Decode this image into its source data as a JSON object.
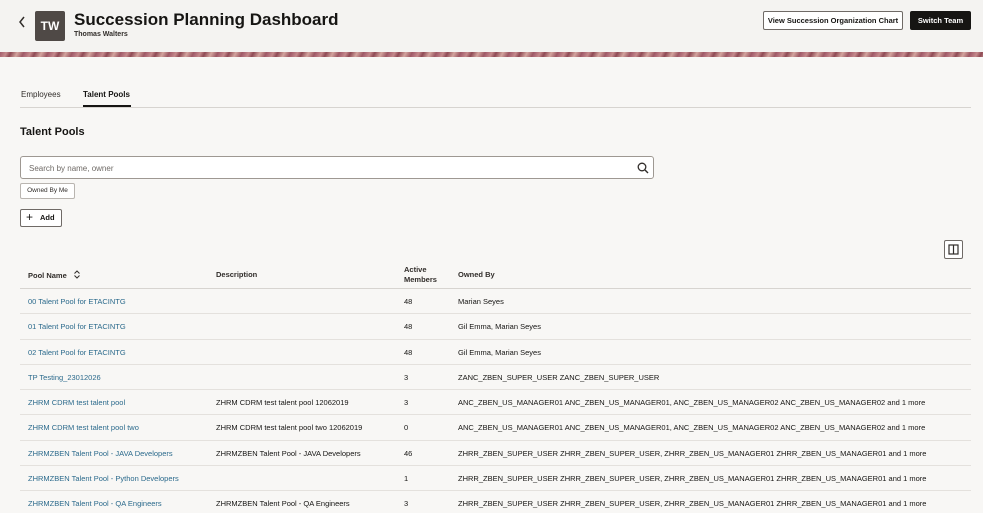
{
  "header": {
    "title": "Succession Planning Dashboard",
    "subtitle": "Thomas Walters",
    "avatar_initials": "TW",
    "back_icon": "chevron-left-icon",
    "org_chart_button": "View Succession Organization Chart",
    "switch_team_button": "Switch Team"
  },
  "tabs": [
    {
      "label": "Employees",
      "active": false
    },
    {
      "label": "Talent Pools",
      "active": true
    }
  ],
  "section_title": "Talent Pools",
  "search": {
    "placeholder": "Search by name, owner",
    "value": ""
  },
  "filter_chip": "Owned By Me",
  "add_button": "Add",
  "table": {
    "columns": [
      "Pool Name",
      "Description",
      "Active Members",
      "Owned By"
    ],
    "rows": [
      {
        "name": "00 Talent Pool for ETACINTG",
        "description": "",
        "members": "48",
        "owner": "Marian Seyes"
      },
      {
        "name": "01 Talent Pool for ETACINTG",
        "description": "",
        "members": "48",
        "owner": "Gil Emma, Marian Seyes"
      },
      {
        "name": "02 Talent Pool for ETACINTG",
        "description": "",
        "members": "48",
        "owner": "Gil Emma, Marian Seyes"
      },
      {
        "name": "TP Testing_23012026",
        "description": "",
        "members": "3",
        "owner": "ZANC_ZBEN_SUPER_USER ZANC_ZBEN_SUPER_USER"
      },
      {
        "name": "ZHRM CDRM test talent pool",
        "description": "ZHRM CDRM test talent pool 12062019",
        "members": "3",
        "owner": "ANC_ZBEN_US_MANAGER01 ANC_ZBEN_US_MANAGER01, ANC_ZBEN_US_MANAGER02 ANC_ZBEN_US_MANAGER02 and 1 more"
      },
      {
        "name": "ZHRM CDRM test talent pool two",
        "description": "ZHRM CDRM test talent pool two 12062019",
        "members": "0",
        "owner": "ANC_ZBEN_US_MANAGER01 ANC_ZBEN_US_MANAGER01, ANC_ZBEN_US_MANAGER02 ANC_ZBEN_US_MANAGER02 and 1 more"
      },
      {
        "name": "ZHRMZBEN Talent Pool - JAVA Developers",
        "description": "ZHRMZBEN Talent Pool - JAVA Developers",
        "members": "46",
        "owner": "ZHRR_ZBEN_SUPER_USER ZHRR_ZBEN_SUPER_USER, ZHRR_ZBEN_US_MANAGER01 ZHRR_ZBEN_US_MANAGER01 and 1 more"
      },
      {
        "name": "ZHRMZBEN Talent Pool - Python Developers",
        "description": "",
        "members": "1",
        "owner": "ZHRR_ZBEN_SUPER_USER ZHRR_ZBEN_SUPER_USER, ZHRR_ZBEN_US_MANAGER01 ZHRR_ZBEN_US_MANAGER01 and 1 more"
      },
      {
        "name": "ZHRMZBEN Talent Pool - QA Engineers",
        "description": "ZHRMZBEN Talent Pool - QA Engineers",
        "members": "3",
        "owner": "ZHRR_ZBEN_SUPER_USER ZHRR_ZBEN_SUPER_USER, ZHRR_ZBEN_US_MANAGER01 ZHRR_ZBEN_US_MANAGER01 and 1 more"
      }
    ]
  }
}
